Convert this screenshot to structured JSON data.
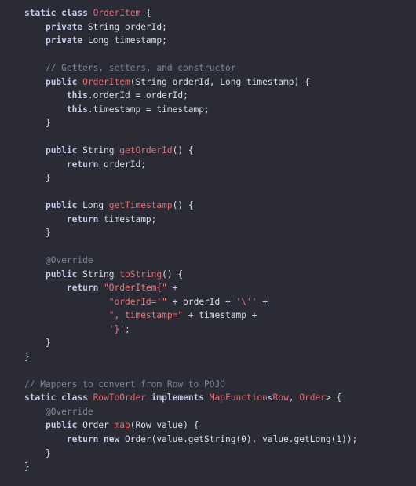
{
  "editor": {
    "language": "java",
    "background_color": "#2b2b35",
    "colors": {
      "plain": "#d8dde8",
      "keyword": "#c3cbe8",
      "type": "#e06c75",
      "function": "#e06c75",
      "string": "#e3787e",
      "comment": "#7f8596",
      "annotation": "#7f8596",
      "operator": "#c3cbe8"
    },
    "lines": [
      {
        "n": 1,
        "tokens": [
          {
            "c": "kw",
            "t": "static class "
          },
          {
            "c": "type",
            "t": "OrderItem"
          },
          {
            "c": "plain",
            "t": " {"
          }
        ]
      },
      {
        "n": 2,
        "tokens": [
          {
            "c": "plain",
            "t": "    "
          },
          {
            "c": "kw",
            "t": "private"
          },
          {
            "c": "plain",
            "t": " String orderId;"
          }
        ]
      },
      {
        "n": 3,
        "tokens": [
          {
            "c": "plain",
            "t": "    "
          },
          {
            "c": "kw",
            "t": "private"
          },
          {
            "c": "plain",
            "t": " Long timestamp;"
          }
        ]
      },
      {
        "n": 4,
        "tokens": []
      },
      {
        "n": 5,
        "tokens": [
          {
            "c": "plain",
            "t": "    "
          },
          {
            "c": "comment",
            "t": "// Getters, setters, and constructor"
          }
        ]
      },
      {
        "n": 6,
        "tokens": [
          {
            "c": "plain",
            "t": "    "
          },
          {
            "c": "kw",
            "t": "public "
          },
          {
            "c": "fn",
            "t": "OrderItem"
          },
          {
            "c": "plain",
            "t": "(String orderId, Long timestamp) {"
          }
        ]
      },
      {
        "n": 7,
        "tokens": [
          {
            "c": "plain",
            "t": "        "
          },
          {
            "c": "kw",
            "t": "this"
          },
          {
            "c": "plain",
            "t": ".orderId = orderId;"
          }
        ]
      },
      {
        "n": 8,
        "tokens": [
          {
            "c": "plain",
            "t": "        "
          },
          {
            "c": "kw",
            "t": "this"
          },
          {
            "c": "plain",
            "t": ".timestamp = timestamp;"
          }
        ]
      },
      {
        "n": 9,
        "tokens": [
          {
            "c": "plain",
            "t": "    }"
          }
        ]
      },
      {
        "n": 10,
        "tokens": []
      },
      {
        "n": 11,
        "tokens": [
          {
            "c": "plain",
            "t": "    "
          },
          {
            "c": "kw",
            "t": "public"
          },
          {
            "c": "plain",
            "t": " String "
          },
          {
            "c": "fn",
            "t": "getOrderId"
          },
          {
            "c": "plain",
            "t": "() {"
          }
        ]
      },
      {
        "n": 12,
        "tokens": [
          {
            "c": "plain",
            "t": "        "
          },
          {
            "c": "kw",
            "t": "return"
          },
          {
            "c": "plain",
            "t": " orderId;"
          }
        ]
      },
      {
        "n": 13,
        "tokens": [
          {
            "c": "plain",
            "t": "    }"
          }
        ]
      },
      {
        "n": 14,
        "tokens": []
      },
      {
        "n": 15,
        "tokens": [
          {
            "c": "plain",
            "t": "    "
          },
          {
            "c": "kw",
            "t": "public"
          },
          {
            "c": "plain",
            "t": " Long "
          },
          {
            "c": "fn",
            "t": "getTimestamp"
          },
          {
            "c": "plain",
            "t": "() {"
          }
        ]
      },
      {
        "n": 16,
        "tokens": [
          {
            "c": "plain",
            "t": "        "
          },
          {
            "c": "kw",
            "t": "return"
          },
          {
            "c": "plain",
            "t": " timestamp;"
          }
        ]
      },
      {
        "n": 17,
        "tokens": [
          {
            "c": "plain",
            "t": "    }"
          }
        ]
      },
      {
        "n": 18,
        "tokens": []
      },
      {
        "n": 19,
        "tokens": [
          {
            "c": "plain",
            "t": "    "
          },
          {
            "c": "anno",
            "t": "@Override"
          }
        ]
      },
      {
        "n": 20,
        "tokens": [
          {
            "c": "plain",
            "t": "    "
          },
          {
            "c": "kw",
            "t": "public"
          },
          {
            "c": "plain",
            "t": " String "
          },
          {
            "c": "fn",
            "t": "toString"
          },
          {
            "c": "plain",
            "t": "() {"
          }
        ]
      },
      {
        "n": 21,
        "tokens": [
          {
            "c": "plain",
            "t": "        "
          },
          {
            "c": "kw",
            "t": "return"
          },
          {
            "c": "plain",
            "t": " "
          },
          {
            "c": "str",
            "t": "\"OrderItem{\""
          },
          {
            "c": "plain",
            "t": " "
          },
          {
            "c": "op",
            "t": "+"
          }
        ]
      },
      {
        "n": 22,
        "tokens": [
          {
            "c": "plain",
            "t": "                "
          },
          {
            "c": "str",
            "t": "\"orderId='\""
          },
          {
            "c": "plain",
            "t": " "
          },
          {
            "c": "op",
            "t": "+"
          },
          {
            "c": "plain",
            "t": " orderId "
          },
          {
            "c": "op",
            "t": "+"
          },
          {
            "c": "plain",
            "t": " "
          },
          {
            "c": "str",
            "t": "'\\''"
          },
          {
            "c": "plain",
            "t": " "
          },
          {
            "c": "op",
            "t": "+"
          }
        ]
      },
      {
        "n": 23,
        "tokens": [
          {
            "c": "plain",
            "t": "                "
          },
          {
            "c": "str",
            "t": "\", timestamp=\""
          },
          {
            "c": "plain",
            "t": " "
          },
          {
            "c": "op",
            "t": "+"
          },
          {
            "c": "plain",
            "t": " timestamp "
          },
          {
            "c": "op",
            "t": "+"
          }
        ]
      },
      {
        "n": 24,
        "tokens": [
          {
            "c": "plain",
            "t": "                "
          },
          {
            "c": "str",
            "t": "'}'"
          },
          {
            "c": "plain",
            "t": ";"
          }
        ]
      },
      {
        "n": 25,
        "tokens": [
          {
            "c": "plain",
            "t": "    }"
          }
        ]
      },
      {
        "n": 26,
        "tokens": [
          {
            "c": "plain",
            "t": "}"
          }
        ]
      },
      {
        "n": 27,
        "tokens": []
      },
      {
        "n": 28,
        "tokens": [
          {
            "c": "comment",
            "t": "// Mappers to convert from Row to POJO"
          }
        ]
      },
      {
        "n": 29,
        "tokens": [
          {
            "c": "kw",
            "t": "static class "
          },
          {
            "c": "type",
            "t": "RowToOrder"
          },
          {
            "c": "plain",
            "t": " "
          },
          {
            "c": "kw",
            "t": "implements"
          },
          {
            "c": "plain",
            "t": " "
          },
          {
            "c": "type",
            "t": "MapFunction"
          },
          {
            "c": "plain",
            "t": "<"
          },
          {
            "c": "type",
            "t": "Row"
          },
          {
            "c": "plain",
            "t": ", "
          },
          {
            "c": "type",
            "t": "Order"
          },
          {
            "c": "plain",
            "t": "> {"
          }
        ]
      },
      {
        "n": 30,
        "tokens": [
          {
            "c": "plain",
            "t": "    "
          },
          {
            "c": "anno",
            "t": "@Override"
          }
        ]
      },
      {
        "n": 31,
        "tokens": [
          {
            "c": "plain",
            "t": "    "
          },
          {
            "c": "kw",
            "t": "public"
          },
          {
            "c": "plain",
            "t": " Order "
          },
          {
            "c": "fn",
            "t": "map"
          },
          {
            "c": "plain",
            "t": "(Row value) {"
          }
        ]
      },
      {
        "n": 32,
        "tokens": [
          {
            "c": "plain",
            "t": "        "
          },
          {
            "c": "kw",
            "t": "return new"
          },
          {
            "c": "plain",
            "t": " Order(value.getString(0), value.getLong(1));"
          }
        ]
      },
      {
        "n": 33,
        "tokens": [
          {
            "c": "plain",
            "t": "    }"
          }
        ]
      },
      {
        "n": 34,
        "tokens": [
          {
            "c": "plain",
            "t": "}"
          }
        ]
      }
    ]
  }
}
